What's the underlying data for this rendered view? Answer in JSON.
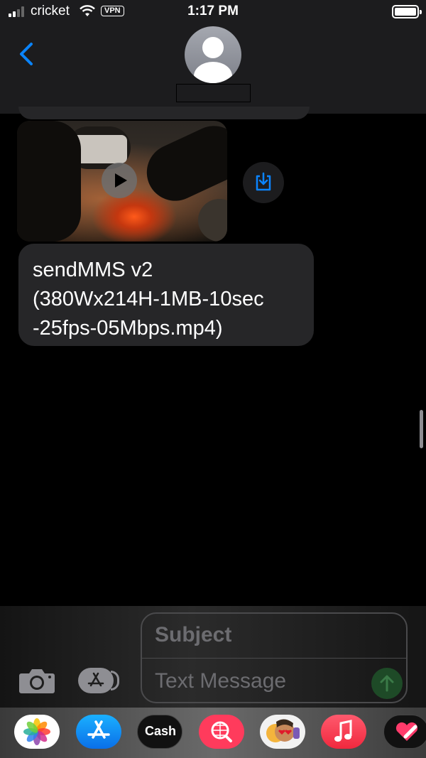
{
  "status_bar": {
    "carrier": "cricket",
    "vpn": "VPN",
    "time": "1:17 PM",
    "signal_bars_filled": 2,
    "signal_bars_total": 4
  },
  "header": {
    "back_icon": "chevron-left-icon",
    "avatar_icon": "person-silhouette-icon",
    "contact_name": ""
  },
  "transcript": {
    "video_attachment": {
      "play_icon": "play-icon",
      "save_icon": "save-to-device-icon"
    },
    "message_text": "sendMMS v2\n(380Wx214H-1MB-10sec\n-25fps-05Mbps.mp4)"
  },
  "composer": {
    "camera_icon": "camera-icon",
    "apps_icon": "app-store-icon",
    "subject_placeholder": "Subject",
    "text_placeholder": "Text Message",
    "send_icon": "arrow-up-icon"
  },
  "app_drawer": {
    "apps": [
      {
        "name": "photos",
        "icon": "photos-icon"
      },
      {
        "name": "app-store",
        "icon": "app-store-icon"
      },
      {
        "name": "apple-cash",
        "label": "Cash",
        "icon": "apple-icon"
      },
      {
        "name": "image-search",
        "icon": "globe-search-icon"
      },
      {
        "name": "memoji",
        "icon": "memoji-icon"
      },
      {
        "name": "music",
        "icon": "music-note-icon"
      },
      {
        "name": "digital-touch",
        "icon": "heart-icon"
      }
    ]
  },
  "colors": {
    "ios_blue": "#0a84ff",
    "bubble_gray": "#262628",
    "send_green": "#1e4a27"
  }
}
